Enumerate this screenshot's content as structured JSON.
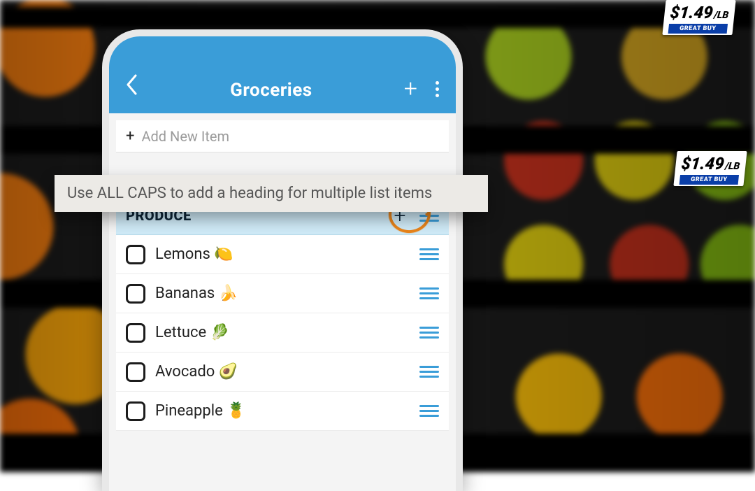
{
  "background": {
    "price_tags": [
      {
        "price": "$1.49",
        "unit": "/LB",
        "banner": "GREAT BUY"
      },
      {
        "price": "$1.49",
        "unit": "/LB",
        "banner": "GREAT BUY"
      }
    ]
  },
  "phone": {
    "header": {
      "title": "Groceries"
    },
    "add_new": {
      "placeholder": "Add New Item"
    },
    "section": {
      "label": "PRODUCE"
    },
    "items": [
      {
        "label": "Lemons 🍋"
      },
      {
        "label": "Bananas 🍌"
      },
      {
        "label": "Lettuce 🥬"
      },
      {
        "label": "Avocado 🥑"
      },
      {
        "label": "Pineapple 🍍"
      }
    ]
  },
  "tooltip": {
    "text": "Use ALL CAPS to add a heading for multiple list items"
  },
  "colors": {
    "header_blue": "#3a9dd8",
    "section_bg": "#cfeaf7",
    "annotation_orange": "#e8841b"
  }
}
